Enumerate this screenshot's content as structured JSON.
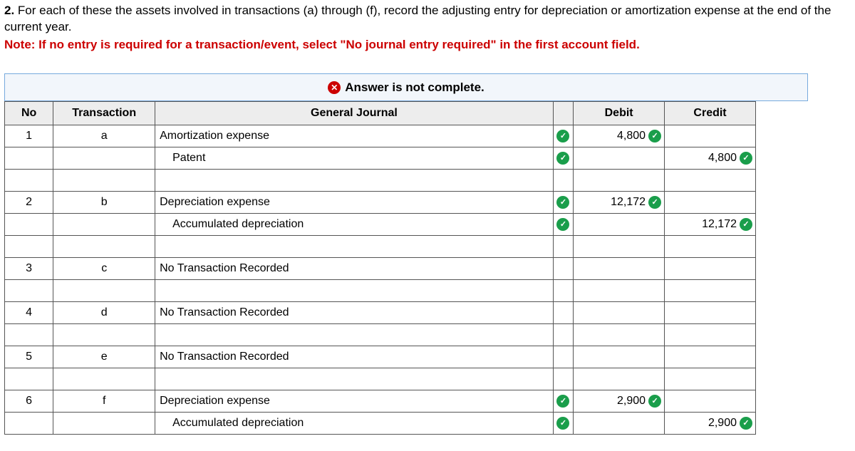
{
  "question": {
    "prefix": "2.",
    "body": " For each of these the assets involved in transactions (a) through (f), record the adjusting entry for depreciation or amortization expense at the end of the current year.",
    "note": "Note: If no entry is required for a transaction/event, select \"No journal entry required\" in the first account field."
  },
  "status": {
    "icon": "x",
    "text": "Answer is not complete."
  },
  "headers": {
    "no": "No",
    "transaction": "Transaction",
    "journal": "General Journal",
    "debit": "Debit",
    "credit": "Credit"
  },
  "rows": [
    {
      "no": "1",
      "trans": "a",
      "account": "Amortization expense",
      "indent": false,
      "acct_ok": true,
      "debit": "4,800",
      "debit_ok": true,
      "credit": "",
      "credit_ok": false
    },
    {
      "no": "",
      "trans": "",
      "account": "Patent",
      "indent": true,
      "acct_ok": true,
      "debit": "",
      "debit_ok": false,
      "credit": "4,800",
      "credit_ok": true
    },
    {
      "spacer": true
    },
    {
      "no": "2",
      "trans": "b",
      "account": "Depreciation expense",
      "indent": false,
      "acct_ok": true,
      "debit": "12,172",
      "debit_ok": true,
      "credit": "",
      "credit_ok": false
    },
    {
      "no": "",
      "trans": "",
      "account": "Accumulated depreciation",
      "indent": true,
      "acct_ok": true,
      "debit": "",
      "debit_ok": false,
      "credit": "12,172",
      "credit_ok": true
    },
    {
      "spacer": true
    },
    {
      "no": "3",
      "trans": "c",
      "account": "No Transaction Recorded",
      "indent": false,
      "acct_ok": false,
      "debit": "",
      "debit_ok": false,
      "credit": "",
      "credit_ok": false
    },
    {
      "spacer": true
    },
    {
      "no": "4",
      "trans": "d",
      "account": "No Transaction Recorded",
      "indent": false,
      "acct_ok": false,
      "debit": "",
      "debit_ok": false,
      "credit": "",
      "credit_ok": false
    },
    {
      "spacer": true
    },
    {
      "no": "5",
      "trans": "e",
      "account": "No Transaction Recorded",
      "indent": false,
      "acct_ok": false,
      "debit": "",
      "debit_ok": false,
      "credit": "",
      "credit_ok": false
    },
    {
      "spacer": true
    },
    {
      "no": "6",
      "trans": "f",
      "account": "Depreciation expense",
      "indent": false,
      "acct_ok": true,
      "debit": "2,900",
      "debit_ok": true,
      "credit": "",
      "credit_ok": false
    },
    {
      "no": "",
      "trans": "",
      "account": "Accumulated depreciation",
      "indent": true,
      "acct_ok": true,
      "debit": "",
      "debit_ok": false,
      "credit": "2,900",
      "credit_ok": true
    }
  ]
}
